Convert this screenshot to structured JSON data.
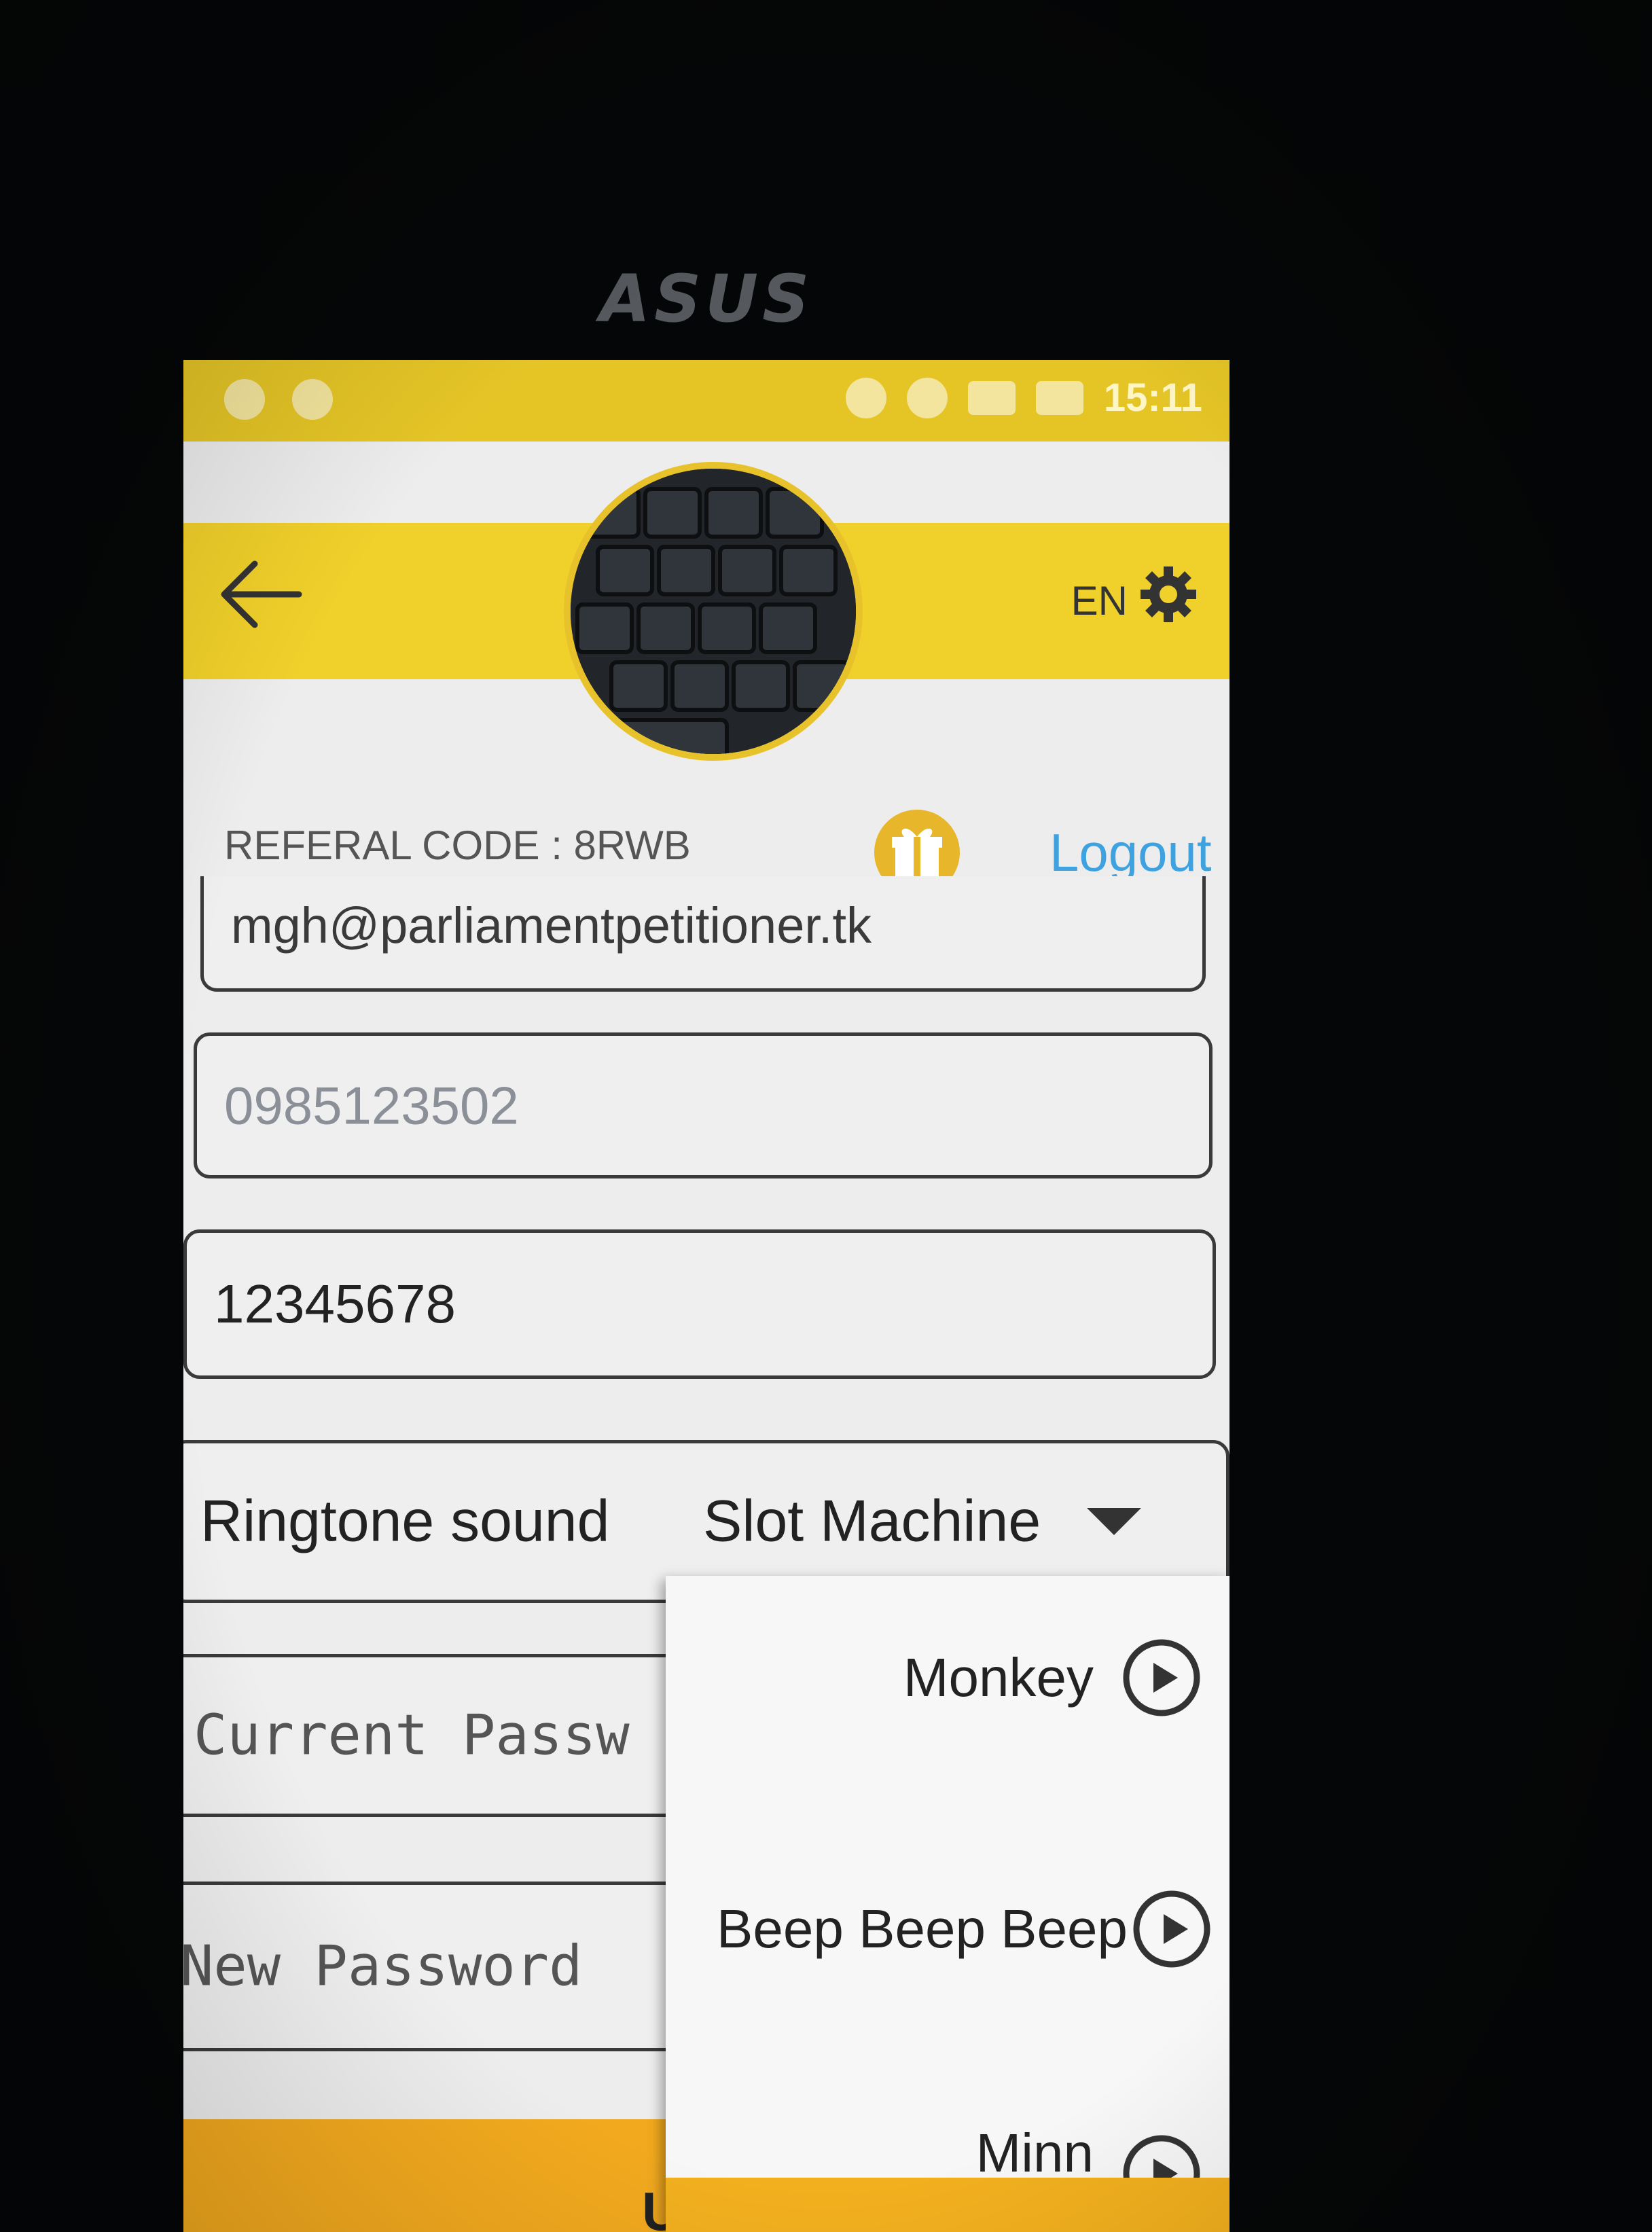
{
  "device": {
    "brand": "ASUS"
  },
  "statusbar": {
    "time": "15:11"
  },
  "header": {
    "lang": "EN"
  },
  "referal": {
    "text": "REFERAL CODE : 8RWB",
    "logout_label": "Logout"
  },
  "form": {
    "email_value": "mgh@parliamentpetitioner.tk",
    "phone_value": "0985123502",
    "password_value": "12345678",
    "ringtone_label": "Ringtone sound",
    "ringtone_value": "Slot Machine",
    "current_password_placeholder": "Current Passw",
    "new_password_placeholder": "New Password",
    "update_label": "UP"
  },
  "dropdown": {
    "items": [
      {
        "label": "Monkey",
        "icon": "play-icon"
      },
      {
        "label": "Beep Beep Beep",
        "icon": "play-icon"
      },
      {
        "label": "Minn",
        "icon": "play-icon"
      }
    ]
  },
  "colors": {
    "accent_yellow": "#f0d02a",
    "logout_blue": "#3ea2e0",
    "button_orange": "#f2a91e"
  }
}
